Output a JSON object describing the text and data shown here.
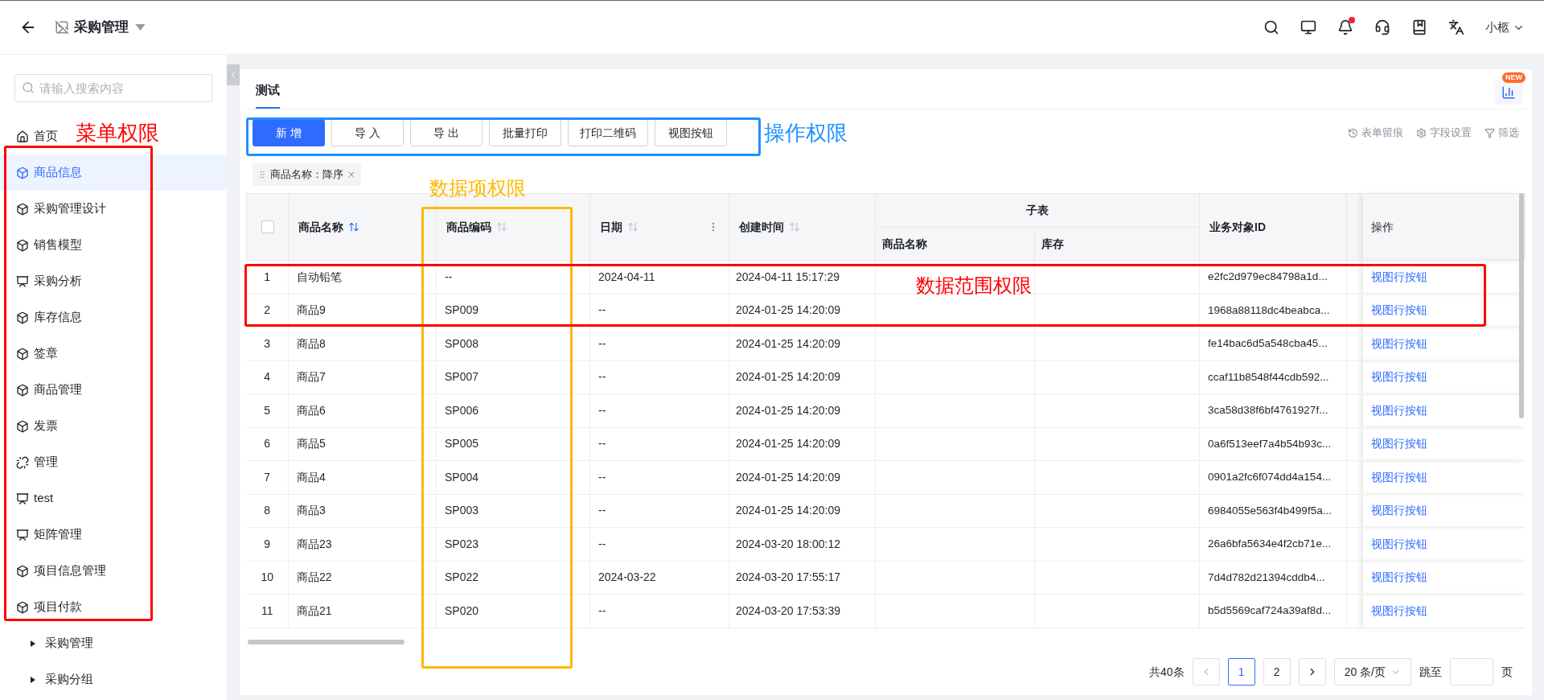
{
  "header": {
    "title": "采购管理",
    "user": "小柩",
    "notification_dot": true
  },
  "sidebar": {
    "search_placeholder": "请输入搜索内容",
    "items": [
      {
        "label": "首页",
        "kind": "home",
        "selected": false
      },
      {
        "label": "商品信息",
        "kind": "module",
        "selected": true
      },
      {
        "label": "采购管理设计",
        "kind": "module",
        "selected": false
      },
      {
        "label": "销售模型",
        "kind": "module",
        "selected": false
      },
      {
        "label": "采购分析",
        "kind": "report",
        "selected": false
      },
      {
        "label": "库存信息",
        "kind": "module",
        "selected": false
      },
      {
        "label": "签章",
        "kind": "module",
        "selected": false
      },
      {
        "label": "商品管理",
        "kind": "module",
        "selected": false
      },
      {
        "label": "发票",
        "kind": "module",
        "selected": false
      },
      {
        "label": "管理",
        "kind": "link",
        "selected": false
      },
      {
        "label": "test",
        "kind": "report",
        "selected": false
      },
      {
        "label": "矩阵管理",
        "kind": "report",
        "selected": false
      },
      {
        "label": "项目信息管理",
        "kind": "module",
        "selected": false
      },
      {
        "label": "项目付款",
        "kind": "module",
        "selected": false
      },
      {
        "label": "采购管理",
        "kind": "group",
        "selected": false
      },
      {
        "label": "采购分组",
        "kind": "group",
        "selected": false
      }
    ]
  },
  "tabs": [
    {
      "label": "测试",
      "selected": true
    }
  ],
  "new_badge": "NEW",
  "buttons": [
    {
      "label": "新 增",
      "primary": true
    },
    {
      "label": "导 入",
      "primary": false
    },
    {
      "label": "导 出",
      "primary": false
    },
    {
      "label": "批量打印",
      "primary": false
    },
    {
      "label": "打印二维码",
      "primary": false
    },
    {
      "label": "视图按钮",
      "primary": false
    }
  ],
  "tools": [
    {
      "label": "表单留痕",
      "kind": "history"
    },
    {
      "label": "字段设置",
      "kind": "settings"
    },
    {
      "label": "筛选",
      "kind": "filter"
    }
  ],
  "sort_tag": "商品名称：降序",
  "table": {
    "select_all_checked": false,
    "columns": [
      {
        "label": "商品名称",
        "sorted": true
      },
      {
        "label": "商品编码",
        "sorted": false
      },
      {
        "label": "日期",
        "sorted": false,
        "menu": true
      },
      {
        "label": "创建时间",
        "sorted": false
      },
      {
        "label": "子表",
        "children": [
          {
            "label": "商品名称"
          },
          {
            "label": "库存"
          }
        ]
      },
      {
        "label": "业务对象ID"
      },
      {
        "label": "操作"
      }
    ],
    "rows": [
      {
        "no": "1",
        "name": "自动铅笔",
        "code": "--",
        "date": "2024-04-11",
        "created": "2024-04-11 15:17:29",
        "id": "e2fc2d979ec84798a1d...",
        "action": "视图行按钮"
      },
      {
        "no": "2",
        "name": "商品9",
        "code": "SP009",
        "date": "--",
        "created": "2024-01-25 14:20:09",
        "id": "1968a88118dc4beabca...",
        "action": "视图行按钮"
      },
      {
        "no": "3",
        "name": "商品8",
        "code": "SP008",
        "date": "--",
        "created": "2024-01-25 14:20:09",
        "id": "fe14bac6d5a548cba45...",
        "action": "视图行按钮"
      },
      {
        "no": "4",
        "name": "商品7",
        "code": "SP007",
        "date": "--",
        "created": "2024-01-25 14:20:09",
        "id": "ccaf11b8548f44cdb592...",
        "action": "视图行按钮"
      },
      {
        "no": "5",
        "name": "商品6",
        "code": "SP006",
        "date": "--",
        "created": "2024-01-25 14:20:09",
        "id": "3ca58d38f6bf4761927f...",
        "action": "视图行按钮"
      },
      {
        "no": "6",
        "name": "商品5",
        "code": "SP005",
        "date": "--",
        "created": "2024-01-25 14:20:09",
        "id": "0a6f513eef7a4b54b93c...",
        "action": "视图行按钮"
      },
      {
        "no": "7",
        "name": "商品4",
        "code": "SP004",
        "date": "--",
        "created": "2024-01-25 14:20:09",
        "id": "0901a2fc6f074dd4a154...",
        "action": "视图行按钮"
      },
      {
        "no": "8",
        "name": "商品3",
        "code": "SP003",
        "date": "--",
        "created": "2024-01-25 14:20:09",
        "id": "6984055e563f4b499f5a...",
        "action": "视图行按钮"
      },
      {
        "no": "9",
        "name": "商品23",
        "code": "SP023",
        "date": "--",
        "created": "2024-03-20 18:00:12",
        "id": "26a6bfa5634e4f2cb71e...",
        "action": "视图行按钮"
      },
      {
        "no": "10",
        "name": "商品22",
        "code": "SP022",
        "date": "2024-03-22",
        "created": "2024-03-20 17:55:17",
        "id": "7d4d782d21394cddb4...",
        "action": "视图行按钮"
      },
      {
        "no": "11",
        "name": "商品21",
        "code": "SP020",
        "date": "--",
        "created": "2024-03-20 17:53:39",
        "id": "b5d5569caf724a39af8d...",
        "action": "视图行按钮"
      }
    ]
  },
  "pagination": {
    "total": "共40条",
    "pages": [
      {
        "label": "1",
        "selected": true
      },
      {
        "label": "2",
        "selected": false
      }
    ],
    "page_size": "20 条/页",
    "jump_label": "跳至",
    "page_suffix": "页"
  },
  "annotations": [
    {
      "label": "菜单权限",
      "color": "#ff0000"
    },
    {
      "label": "操作权限",
      "color": "#1e90ff"
    },
    {
      "label": "数据项权限",
      "color": "#ffb800"
    },
    {
      "label": "数据范围权限",
      "color": "#ff0000"
    }
  ]
}
